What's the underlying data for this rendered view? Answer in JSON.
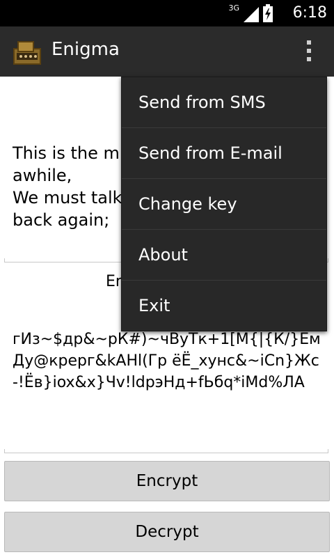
{
  "status_bar": {
    "network": "3G",
    "time": "6:18",
    "icons": [
      "signal-icon",
      "battery-icon"
    ]
  },
  "action_bar": {
    "title": "Enigma",
    "icon": "enigma-machine-icon",
    "overflow_icon": "overflow-menu-icon"
  },
  "main": {
    "plain_text": "This is the m\nawhile,\nWe must talk\nback again;",
    "encrypted_label": "Er",
    "cipher_text": "гИз~$др&~рК#)~чВуТк+1[М{|{К/}ЕмДу@креpг&kАНl(Гр ёЁ_хунс&~iCn}Жс-!Ёв}iox&x}Чv!ldрэНд+fЬбq*iMd%ЛА",
    "encrypt_button": "Encrypt",
    "decrypt_button": "Decrypt"
  },
  "overflow_menu": {
    "items": [
      {
        "label": "Send from SMS"
      },
      {
        "label": "Send from E-mail"
      },
      {
        "label": "Change key"
      },
      {
        "label": "About"
      },
      {
        "label": "Exit"
      }
    ]
  },
  "colors": {
    "status_bar_bg": "#000000",
    "action_bar_bg": "#2b2b2b",
    "menu_bg": "#282828",
    "button_bg": "#d6d6d6"
  }
}
